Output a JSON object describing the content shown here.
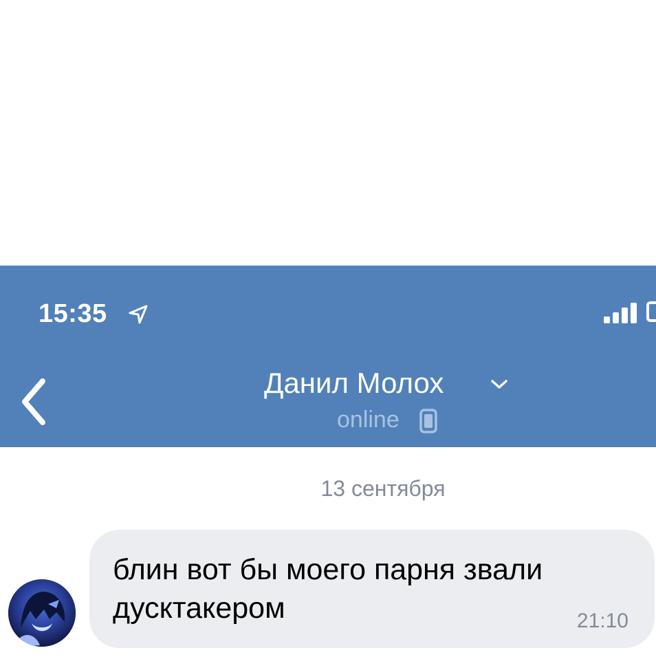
{
  "status_bar": {
    "time": "15:35"
  },
  "header": {
    "contact_name": "Данил Молох",
    "presence": "online",
    "background_color": "#5181b8"
  },
  "chat": {
    "date_separator": "13 сентября",
    "messages": [
      {
        "text": "блин вот бы моего парня звали дусктакером",
        "time": "21:10"
      }
    ]
  },
  "icons": {
    "location": "location-arrow-icon",
    "signal": "cellular-signal-icon",
    "back": "chevron-left-icon",
    "chevron": "chevron-down-icon",
    "device": "phone-icon"
  }
}
